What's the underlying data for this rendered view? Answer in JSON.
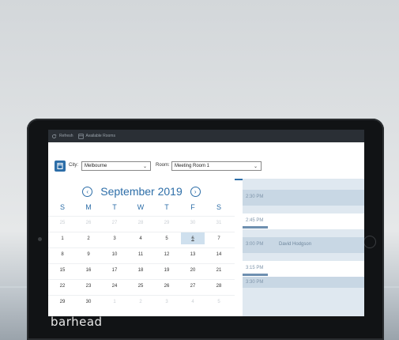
{
  "topbar": {
    "refresh": "Refresh",
    "available_rooms": "Available Rooms"
  },
  "filters": {
    "city_label": "City:",
    "city_value": "Melbourne",
    "room_label": "Room:",
    "room_value": "Meeting Room 1"
  },
  "calendar": {
    "month_label": "September 2019",
    "days_of_week": [
      "S",
      "M",
      "T",
      "W",
      "T",
      "F",
      "S"
    ],
    "weeks": [
      [
        "25",
        "26",
        "27",
        "28",
        "29",
        "30",
        "31"
      ],
      [
        "1",
        "2",
        "3",
        "4",
        "5",
        "6",
        "7"
      ],
      [
        "8",
        "9",
        "10",
        "11",
        "12",
        "13",
        "14"
      ],
      [
        "15",
        "16",
        "17",
        "18",
        "19",
        "20",
        "21"
      ],
      [
        "22",
        "23",
        "24",
        "25",
        "26",
        "27",
        "28"
      ],
      [
        "29",
        "30",
        "1",
        "2",
        "3",
        "4",
        "5"
      ]
    ],
    "selected_day": "6"
  },
  "schedule": {
    "slots": [
      {
        "time": "2:30 PM",
        "title": ""
      },
      {
        "time": "2:45 PM",
        "title": ""
      },
      {
        "time": "3:00 PM",
        "title": "David Hodgson"
      },
      {
        "time": "3:15 PM",
        "title": ""
      },
      {
        "time": "3:30 PM",
        "title": ""
      }
    ]
  },
  "brand": "barhead",
  "colors": {
    "accent": "#2d6ea8",
    "schedule_bg": "#dfe8f0",
    "selected_day_bg": "#cfe0ee"
  }
}
